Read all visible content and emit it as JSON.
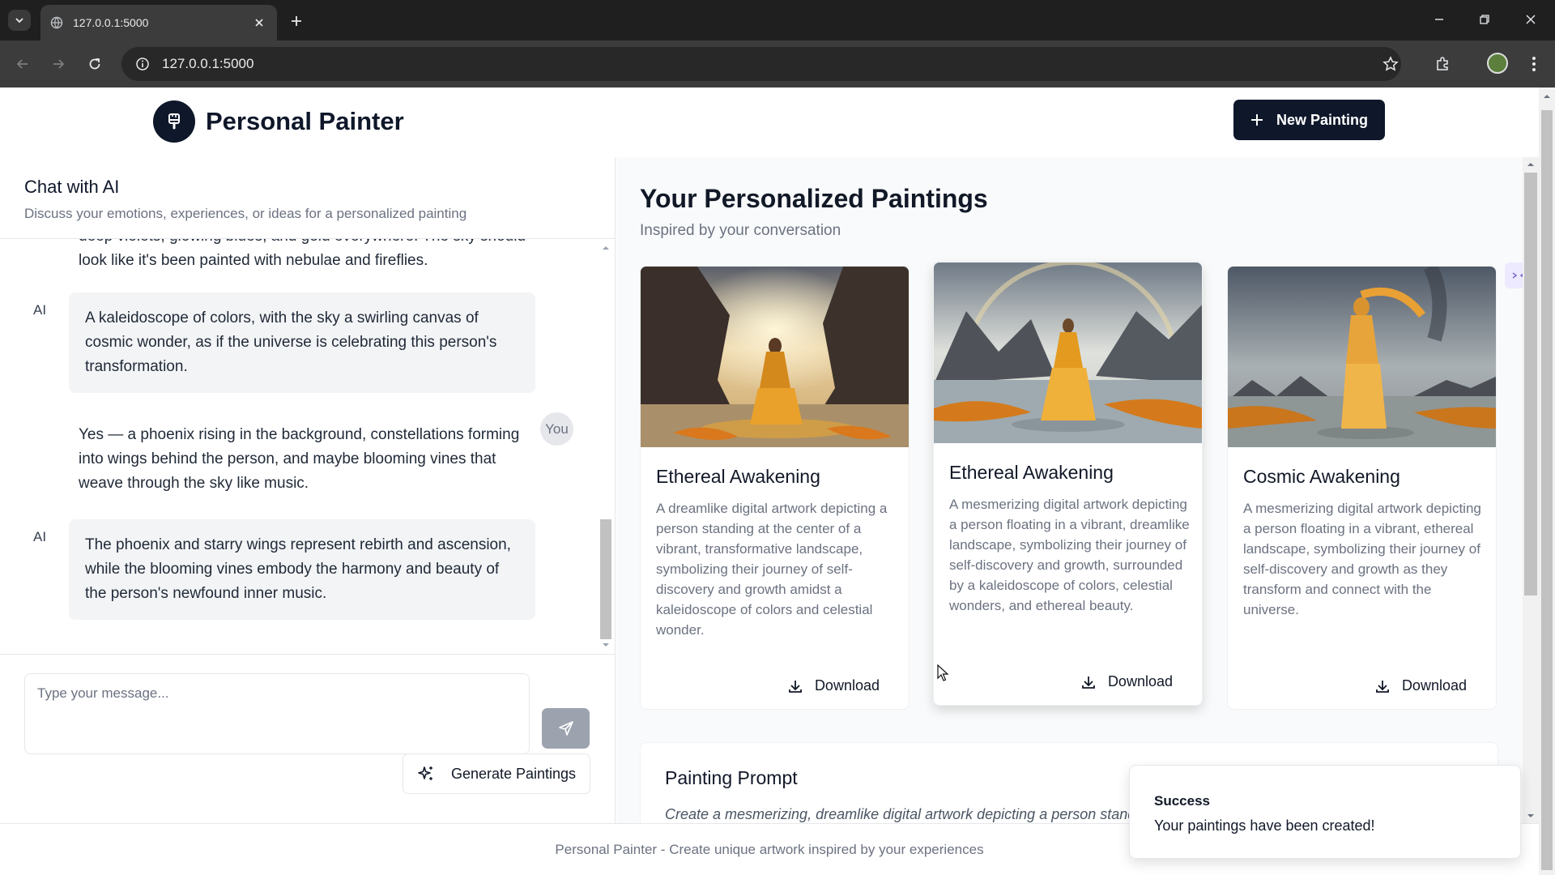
{
  "browser": {
    "tab_title": "127.0.0.1:5000",
    "url": "127.0.0.1:5000"
  },
  "header": {
    "app_title": "Personal Painter",
    "new_painting_label": "New Painting"
  },
  "chat": {
    "title": "Chat with AI",
    "subtitle": "Discuss your emotions, experiences, or ideas for a personalized painting",
    "messages": [
      {
        "role": "user",
        "text": "deep violets, glowing blues, and gold everywhere. The sky should look like it's been painted with nebulae and fireflies."
      },
      {
        "role": "ai",
        "label": "AI",
        "text": "A kaleidoscope of colors, with the sky a swirling canvas of cosmic wonder, as if the universe is celebrating this person's transformation."
      },
      {
        "role": "user",
        "label": "You",
        "text": "Yes — a phoenix rising in the background, constellations forming into wings behind the person, and maybe blooming vines that weave through the sky like music."
      },
      {
        "role": "ai",
        "label": "AI",
        "text": "The phoenix and starry wings represent rebirth and ascension, while the blooming vines embody the harmony and beauty of the person's newfound inner music."
      }
    ],
    "input_placeholder": "Type your message...",
    "generate_label": "Generate Paintings"
  },
  "gallery": {
    "title": "Your Personalized Paintings",
    "subtitle": "Inspired by your conversation",
    "download_label": "Download",
    "cards": [
      {
        "title": "Ethereal Awakening",
        "description": "A dreamlike digital artwork depicting a person standing at the center of a vibrant, transformative landscape, symbolizing their journey of self-discovery and growth amidst a kaleidoscope of colors and celestial wonder."
      },
      {
        "title": "Ethereal Awakening",
        "description": "A mesmerizing digital artwork depicting a person floating in a vibrant, dreamlike landscape, symbolizing their journey of self-discovery and growth, surrounded by a kaleidoscope of colors, celestial wonders, and ethereal beauty."
      },
      {
        "title": "Cosmic Awakening",
        "description": "A mesmerizing digital artwork depicting a person floating in a vibrant, ethereal landscape, symbolizing their journey of self-discovery and growth as they transform and connect with the universe."
      }
    ],
    "prompt_title": "Painting Prompt",
    "prompt_text": "Create a mesmerizing, dreamlike digital artwork depicting a person standing"
  },
  "footer": {
    "text": "Personal Painter - Create unique artwork inspired by your experiences"
  },
  "toast": {
    "title": "Success",
    "message": "Your paintings have been created!"
  },
  "colors": {
    "brand": "#0f172a",
    "muted": "#6b7280",
    "bubble": "#f3f4f6"
  }
}
